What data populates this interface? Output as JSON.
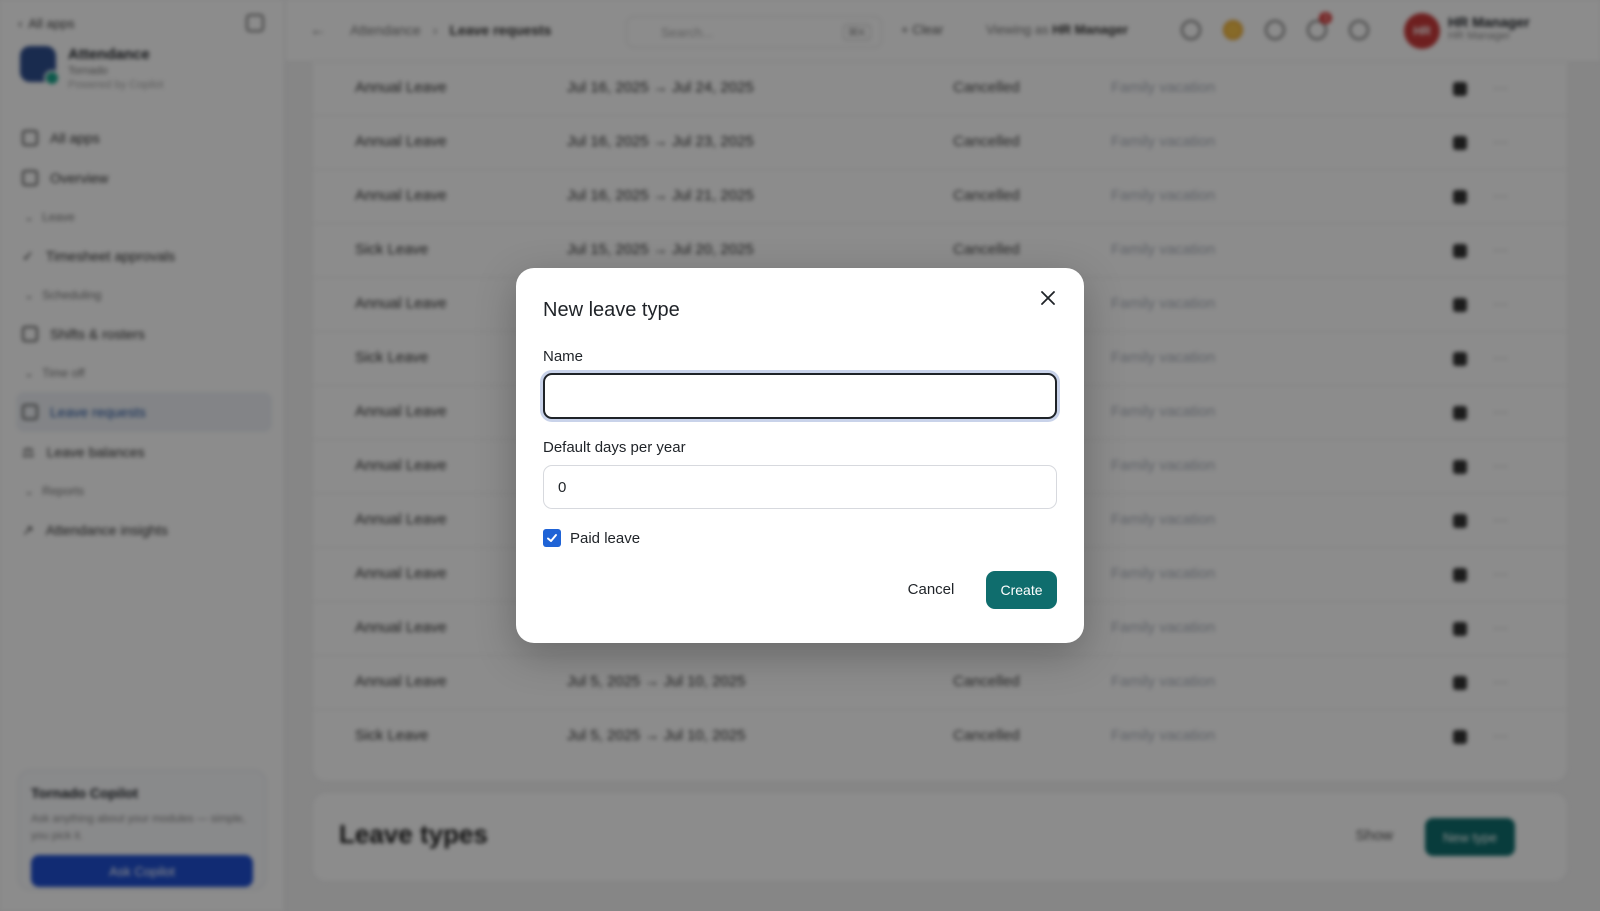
{
  "sidebar": {
    "back_label": "All apps",
    "brand_title": "Attendance",
    "brand_subtitle": "Tornado",
    "brand_caption": "Powered by Copilot",
    "nav_top": [
      "All apps",
      "Overview"
    ],
    "sections": [
      {
        "label": "Leave",
        "items": [
          "Timesheet approvals"
        ]
      },
      {
        "label": "Scheduling",
        "items": [
          "Shifts & rosters"
        ]
      },
      {
        "label": "Time off",
        "items": [
          "Leave requests",
          "Leave balances"
        ]
      },
      {
        "label": "Reports",
        "items": [
          "Attendance insights"
        ]
      }
    ],
    "copilot": {
      "title": "Tornado Copilot",
      "description": "Ask anything about your modules — simple, you pick it.",
      "button_label": "Ask Copilot"
    }
  },
  "topbar": {
    "back_icon": "arrow-left-icon",
    "breadcrumb_root": "Attendance",
    "breadcrumb_current": "Leave requests",
    "search_placeholder": "Search...",
    "search_shortcut": "⌘K",
    "clear_label": "Clear",
    "viewing_as_label": "Viewing as",
    "viewing_as_role": "HR Manager",
    "notification_count": "3",
    "avatar_initials": "HR",
    "user_name": "HR Manager",
    "user_role": "HR Manager"
  },
  "table": {
    "rows": [
      {
        "type": "Annual Leave",
        "dates": "Jul 16, 2025 → Jul 24, 2025",
        "status": "Cancelled",
        "reason": "Family vacation"
      },
      {
        "type": "Annual Leave",
        "dates": "Jul 16, 2025 → Jul 23, 2025",
        "status": "Cancelled",
        "reason": "Family vacation"
      },
      {
        "type": "Annual Leave",
        "dates": "Jul 16, 2025 → Jul 21, 2025",
        "status": "Cancelled",
        "reason": "Family vacation"
      },
      {
        "type": "Sick Leave",
        "dates": "Jul 15, 2025 → Jul 20, 2025",
        "status": "Cancelled",
        "reason": "Family vacation"
      },
      {
        "type": "Annual Leave",
        "dates": "",
        "status": "",
        "reason": "Family vacation"
      },
      {
        "type": "Sick Leave",
        "dates": "",
        "status": "",
        "reason": "Family vacation"
      },
      {
        "type": "Annual Leave",
        "dates": "",
        "status": "",
        "reason": "Family vacation"
      },
      {
        "type": "Annual Leave",
        "dates": "",
        "status": "",
        "reason": "Family vacation"
      },
      {
        "type": "Annual Leave",
        "dates": "",
        "status": "",
        "reason": "Family vacation"
      },
      {
        "type": "Annual Leave",
        "dates": "",
        "status": "",
        "reason": "Family vacation"
      },
      {
        "type": "Annual Leave",
        "dates": "",
        "status": "",
        "reason": "Family vacation"
      },
      {
        "type": "Annual Leave",
        "dates": "Jul 5, 2025 → Jul 10, 2025",
        "status": "Cancelled",
        "reason": "Family vacation"
      },
      {
        "type": "Sick Leave",
        "dates": "Jul 5, 2025 → Jul 10, 2025",
        "status": "Cancelled",
        "reason": "Family vacation"
      }
    ]
  },
  "leave_types": {
    "title": "Leave types",
    "show_label": "Show",
    "new_button_label": "New type"
  },
  "modal": {
    "title": "New leave type",
    "close_icon": "close-icon",
    "name_label": "Name",
    "name_value": "",
    "days_label": "Default days per year",
    "days_value": "0",
    "paid_checked": true,
    "paid_label": "Paid leave",
    "cancel_label": "Cancel",
    "create_label": "Create"
  },
  "colors": {
    "primary_button": "#0f6d6d",
    "checkbox": "#1f63d6",
    "overlay": "rgba(0,0,0,0.45)"
  }
}
